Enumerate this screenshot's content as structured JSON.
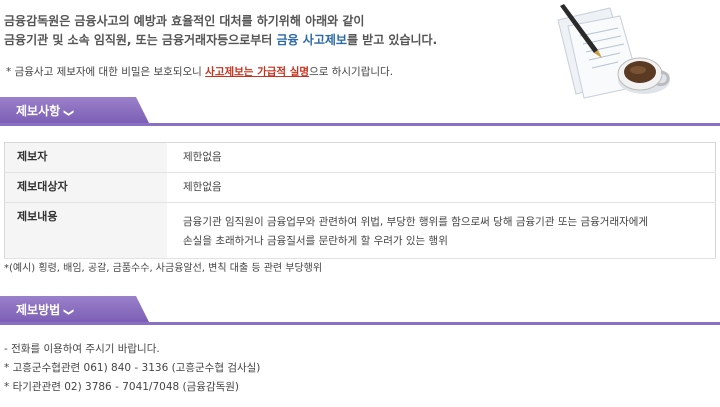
{
  "intro": {
    "line1": "금융감독원은 금융사고의 예방과 효율적인 대처를 하기위해 아래와 같이",
    "line2_prefix": "금융기관 및 소속 임직원, 또는 금융거래자등으로부터 ",
    "line2_highlight": "금융 사고제보",
    "line2_suffix": "를 받고 있습니다."
  },
  "note": {
    "prefix": "* 금융사고 제보자에 대한 비밀은 보호되오니 ",
    "highlight": "사고제보는 가급적 실명",
    "suffix": "으로 하시기랍니다."
  },
  "section1": {
    "title": "제보사항",
    "chevron": "❯"
  },
  "table": {
    "rows": [
      {
        "label": "제보자",
        "value": "제한없음"
      },
      {
        "label": "제보대상자",
        "value": "제한없음"
      },
      {
        "label": "제보내용",
        "value_line1": "금융기관 임직원이 금융업무와 관련하여 위법, 부당한 행위를 함으로써 당해 금융기관 또는 금융거래자에게",
        "value_line2": "손실을 초래하거나 금융질서를 문란하게 할 우려가 있는 행위"
      }
    ]
  },
  "example": "*(예시) 횡령, 배임, 공갈, 금품수수, 사금융알선, 변칙 대출 등 관련 부당행위",
  "section2": {
    "title": "제보방법",
    "chevron": "❯"
  },
  "methods": [
    "- 전화를 이용하여 주시기 바랍니다.",
    "* 고흥군수협관련  061) 840 - 3136 (고흥군수협 검사실)",
    "* 타기관관련  02) 3786 - 7041/7048 (금융감독원)"
  ],
  "colors": {
    "accent": "#8a70c4",
    "highlight_blue": "#2a6aa8",
    "highlight_red": "#c8321e"
  },
  "icons": {
    "illustration": "documents-pen-coffee-icon"
  }
}
